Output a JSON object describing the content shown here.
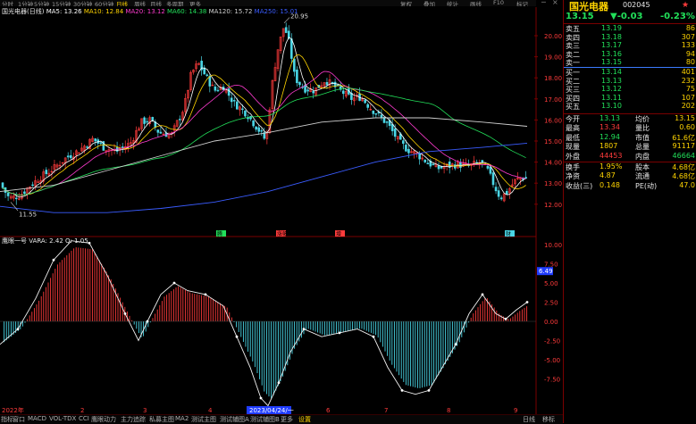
{
  "toolbar": {
    "timeframes": [
      "分时",
      "1分钟",
      "5分钟",
      "15分钟",
      "30分钟",
      "60分钟",
      "日线",
      "周线",
      "月线",
      "多周期",
      "更多"
    ],
    "active_timeframe": "日线",
    "right_tabs": [
      "复权",
      "叠加",
      "统计",
      "画线",
      "F10",
      "标记"
    ]
  },
  "chart_header": {
    "stock_name": "国光电器(日线)",
    "ma_items": [
      {
        "label": "MA5: 13.26",
        "color": "#ffffff"
      },
      {
        "label": "MA10: 12.84",
        "color": "#ffd400"
      },
      {
        "label": "MA20: 13.12",
        "color": "#ff3bd0"
      },
      {
        "label": "MA60: 14.38",
        "color": "#22e05a"
      },
      {
        "label": "MA120: 15.72",
        "color": "#d0d0d0"
      },
      {
        "label": "MA250: 15.01",
        "color": "#3a5cff"
      }
    ]
  },
  "price_axis": [
    "20.00",
    "19.00",
    "18.00",
    "17.00",
    "16.00",
    "15.00",
    "14.00",
    "13.00",
    "12.00"
  ],
  "annotations": {
    "high": "20.95",
    "low": "11.55"
  },
  "event_markers": [
    "腾",
    "涨幅",
    "增",
    "财"
  ],
  "indicator": {
    "title": "鹰眼一号 VARA: 2.42 Q: 1.05",
    "axis": [
      "10.00",
      "7.50",
      "5.00",
      "2.50",
      "0.00",
      "-2.50",
      "-5.00",
      "-7.50"
    ],
    "current_label": "6.49"
  },
  "date_axis": {
    "labels": [
      "2022年",
      "2",
      "3",
      "4",
      "5",
      "6",
      "7",
      "8",
      "9"
    ],
    "cursor_date": "2023/04/24/一"
  },
  "bottom_tabs": [
    "指标",
    "窗口",
    "MACD",
    "VOL-TDX",
    "CCI",
    "鹰眼动力",
    "主力追踪",
    "私募主图",
    "MA2",
    "测试主图",
    "测试辅图A",
    "测试辅图B",
    "更多",
    "设置"
  ],
  "bottom_right": [
    "日线",
    "移标"
  ],
  "quote": {
    "name": "国光电器",
    "code": "002045",
    "price": "13.15",
    "change": "▼-0.03",
    "change_pct": "-0.23%",
    "asks": [
      {
        "label": "卖五",
        "price": "13.19",
        "vol": "86"
      },
      {
        "label": "卖四",
        "price": "13.18",
        "vol": "307"
      },
      {
        "label": "卖三",
        "price": "13.17",
        "vol": "133"
      },
      {
        "label": "卖二",
        "price": "13.16",
        "vol": "94"
      },
      {
        "label": "卖一",
        "price": "13.15",
        "vol": "80"
      }
    ],
    "bids": [
      {
        "label": "买一",
        "price": "13.14",
        "vol": "401"
      },
      {
        "label": "买二",
        "price": "13.13",
        "vol": "232"
      },
      {
        "label": "买三",
        "price": "13.12",
        "vol": "75"
      },
      {
        "label": "买四",
        "price": "13.11",
        "vol": "107"
      },
      {
        "label": "买五",
        "price": "13.10",
        "vol": "202"
      }
    ],
    "stats": [
      {
        "l1": "今开",
        "v1": "13.13",
        "c1": "green",
        "l2": "均价",
        "v2": "13.15",
        "c2": "yellow"
      },
      {
        "l1": "最高",
        "v1": "13.34",
        "c1": "red",
        "l2": "量比",
        "v2": "0.60",
        "c2": "yellow"
      },
      {
        "l1": "最低",
        "v1": "12.94",
        "c1": "green",
        "l2": "市值",
        "v2": "61.6亿",
        "c2": "yellow"
      },
      {
        "l1": "现量",
        "v1": "1807",
        "c1": "yellow",
        "l2": "总量",
        "v2": "91117",
        "c2": "yellow"
      },
      {
        "l1": "外盘",
        "v1": "44453",
        "c1": "red",
        "l2": "内盘",
        "v2": "46664",
        "c2": "green"
      }
    ],
    "stats2": [
      {
        "l1": "换手",
        "v1": "1.95%",
        "l2": "股本",
        "v2": "4.68亿"
      },
      {
        "l1": "净资",
        "v1": "4.87",
        "l2": "流通",
        "v2": "4.68亿"
      },
      {
        "l1": "收益(三)",
        "v1": "0.148",
        "l2": "PE(动)",
        "v2": "47.0"
      }
    ]
  }
}
